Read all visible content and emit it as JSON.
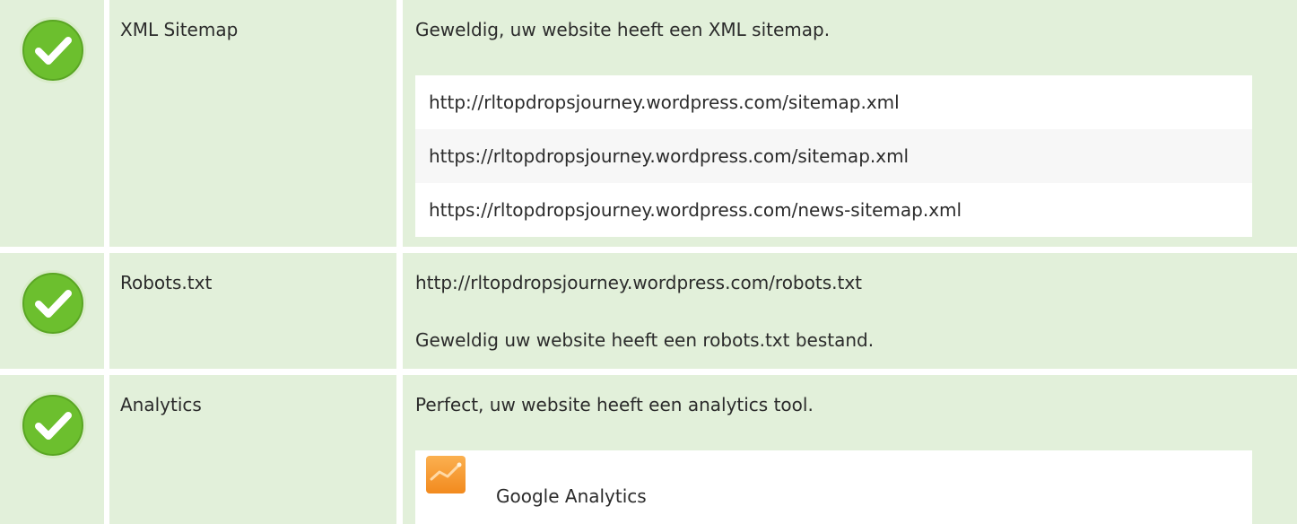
{
  "rows": [
    {
      "label": "XML Sitemap",
      "status_icon": "check-circle-icon",
      "message": "Geweldig, uw website heeft een XML sitemap.",
      "sitemaps": [
        "http://rltopdropsjourney.wordpress.com/sitemap.xml",
        "https://rltopdropsjourney.wordpress.com/sitemap.xml",
        "https://rltopdropsjourney.wordpress.com/news-sitemap.xml"
      ]
    },
    {
      "label": "Robots.txt",
      "status_icon": "check-circle-icon",
      "url": "http://rltopdropsjourney.wordpress.com/robots.txt",
      "message": "Geweldig uw website heeft een robots.txt bestand."
    },
    {
      "label": "Analytics",
      "status_icon": "check-circle-icon",
      "message": "Perfect, uw website heeft een analytics tool.",
      "tools": [
        {
          "name": "Google Analytics",
          "icon": "google-analytics-icon"
        }
      ]
    }
  ],
  "colors": {
    "row_background": "#e2f0da",
    "check_green": "#6cbf2e",
    "check_ring": "#d9ecca"
  }
}
